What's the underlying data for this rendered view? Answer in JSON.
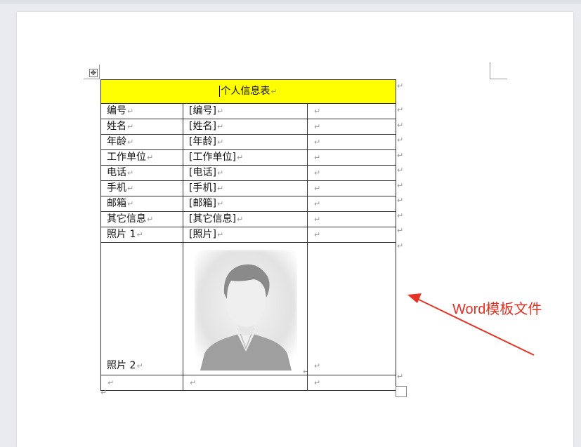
{
  "table": {
    "title": "个人信息表",
    "rows": [
      {
        "label": "编号",
        "value": "[编号]"
      },
      {
        "label": "姓名",
        "value": "[姓名]"
      },
      {
        "label": "年龄",
        "value": "[年龄]"
      },
      {
        "label": "工作单位",
        "value": "[工作单位]"
      },
      {
        "label": "电话",
        "value": "[电话]"
      },
      {
        "label": "手机",
        "value": "[手机]"
      },
      {
        "label": "邮箱",
        "value": "[邮箱]"
      },
      {
        "label": "其它信息",
        "value": "[其它信息]"
      },
      {
        "label": "照片 1",
        "value": "[照片]"
      }
    ],
    "photo_label": "照片 2"
  },
  "marks": {
    "paragraph": "↵",
    "move_handle": "✥"
  },
  "annotation": {
    "text": "Word模板文件",
    "color": "#e53224"
  },
  "colors": {
    "title_bg": "#ffff00"
  }
}
